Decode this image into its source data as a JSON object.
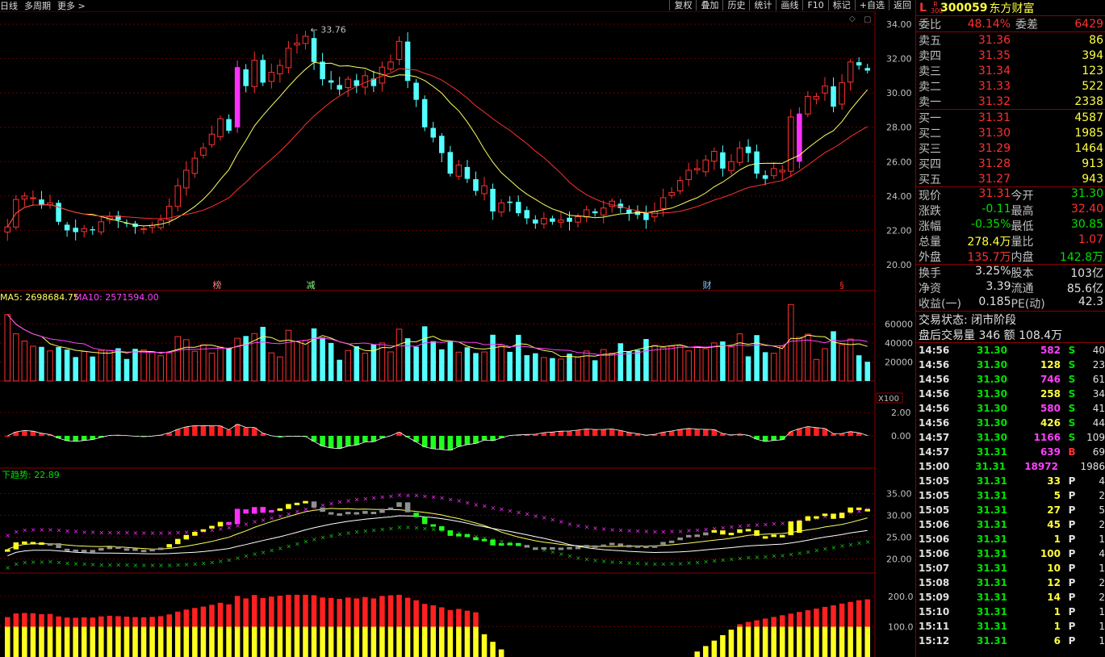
{
  "toolbar": {
    "left": [
      "日线",
      "多周期",
      "更多 >"
    ],
    "right": [
      "复权",
      "叠加",
      "历史",
      "统计",
      "画线",
      "F10",
      "标记",
      "+自选",
      "返回"
    ]
  },
  "stock": {
    "code": "300059",
    "name": "东方财富",
    "market_letter": "L",
    "market_sub": "R 300"
  },
  "weibi": {
    "label": "委比",
    "value": "48.14%",
    "label2": "委差",
    "value2": "6429"
  },
  "sell": [
    {
      "label": "卖五",
      "price": "31.36",
      "vol": "86"
    },
    {
      "label": "卖四",
      "price": "31.35",
      "vol": "394"
    },
    {
      "label": "卖三",
      "price": "31.34",
      "vol": "123"
    },
    {
      "label": "卖二",
      "price": "31.33",
      "vol": "522"
    },
    {
      "label": "卖一",
      "price": "31.32",
      "vol": "2338"
    }
  ],
  "buy": [
    {
      "label": "买一",
      "price": "31.31",
      "vol": "4587"
    },
    {
      "label": "买二",
      "price": "31.30",
      "vol": "1985"
    },
    {
      "label": "买三",
      "price": "31.29",
      "vol": "1464"
    },
    {
      "label": "买四",
      "price": "31.28",
      "vol": "913"
    },
    {
      "label": "买五",
      "price": "31.27",
      "vol": "943"
    }
  ],
  "quote1": [
    {
      "a": "现价",
      "av": "31.31",
      "ac": "up",
      "b": "今开",
      "bv": "31.30",
      "bc": "dn"
    },
    {
      "a": "涨跌",
      "av": "-0.11",
      "ac": "dn",
      "b": "最高",
      "bv": "32.40",
      "bc": "up"
    },
    {
      "a": "涨幅",
      "av": "-0.35%",
      "ac": "dn",
      "b": "最低",
      "bv": "30.85",
      "bc": "dn"
    },
    {
      "a": "总量",
      "av": "278.4万",
      "ac": "yel",
      "b": "量比",
      "bv": "1.07",
      "bc": "up"
    },
    {
      "a": "外盘",
      "av": "135.7万",
      "ac": "up",
      "b": "内盘",
      "bv": "142.8万",
      "bc": "dn"
    }
  ],
  "quote2": [
    {
      "a": "换手",
      "av": "3.25%",
      "b": "股本",
      "bv": "103亿"
    },
    {
      "a": "净资",
      "av": "3.39",
      "b": "流通",
      "bv": "85.6亿"
    },
    {
      "a": "收益(一)",
      "av": "0.185",
      "b": "PE(动)",
      "bv": "42.3"
    }
  ],
  "status": {
    "line1": "交易状态: 闭市阶段",
    "line2": "盘后交易量 346 额 108.4万"
  },
  "ticks": [
    {
      "t": "14:56",
      "p": "31.30",
      "pc": "dn",
      "v": "582",
      "vc": "mag",
      "d": "S",
      "dc": "dn",
      "n": "40"
    },
    {
      "t": "14:56",
      "p": "31.30",
      "pc": "dn",
      "v": "128",
      "vc": "yel",
      "d": "S",
      "dc": "dn",
      "n": "23"
    },
    {
      "t": "14:56",
      "p": "31.30",
      "pc": "dn",
      "v": "746",
      "vc": "mag",
      "d": "S",
      "dc": "dn",
      "n": "61"
    },
    {
      "t": "14:56",
      "p": "31.30",
      "pc": "dn",
      "v": "258",
      "vc": "yel",
      "d": "S",
      "dc": "dn",
      "n": "34"
    },
    {
      "t": "14:56",
      "p": "31.30",
      "pc": "dn",
      "v": "580",
      "vc": "mag",
      "d": "S",
      "dc": "dn",
      "n": "41"
    },
    {
      "t": "14:56",
      "p": "31.30",
      "pc": "dn",
      "v": "426",
      "vc": "yel",
      "d": "S",
      "dc": "dn",
      "n": "44"
    },
    {
      "t": "14:57",
      "p": "31.30",
      "pc": "dn",
      "v": "1166",
      "vc": "mag",
      "d": "S",
      "dc": "dn",
      "n": "109"
    },
    {
      "t": "14:57",
      "p": "31.31",
      "pc": "dn",
      "v": "639",
      "vc": "mag",
      "d": "B",
      "dc": "up",
      "n": "69"
    },
    {
      "t": "15:00",
      "p": "31.31",
      "pc": "dn",
      "v": "18972",
      "vc": "mag",
      "d": "",
      "dc": "dn",
      "n": "1986"
    },
    {
      "t": "15:05",
      "p": "31.31",
      "pc": "dn",
      "v": "33",
      "vc": "yel",
      "d": "P",
      "dc": "wht",
      "n": "4"
    },
    {
      "t": "15:05",
      "p": "31.31",
      "pc": "dn",
      "v": "5",
      "vc": "yel",
      "d": "P",
      "dc": "wht",
      "n": "2"
    },
    {
      "t": "15:05",
      "p": "31.31",
      "pc": "dn",
      "v": "27",
      "vc": "yel",
      "d": "P",
      "dc": "wht",
      "n": "5"
    },
    {
      "t": "15:06",
      "p": "31.31",
      "pc": "dn",
      "v": "45",
      "vc": "yel",
      "d": "P",
      "dc": "wht",
      "n": "2"
    },
    {
      "t": "15:06",
      "p": "31.31",
      "pc": "dn",
      "v": "1",
      "vc": "yel",
      "d": "P",
      "dc": "wht",
      "n": "1"
    },
    {
      "t": "15:06",
      "p": "31.31",
      "pc": "dn",
      "v": "100",
      "vc": "yel",
      "d": "P",
      "dc": "wht",
      "n": "4"
    },
    {
      "t": "15:07",
      "p": "31.31",
      "pc": "dn",
      "v": "10",
      "vc": "yel",
      "d": "P",
      "dc": "wht",
      "n": "1"
    },
    {
      "t": "15:08",
      "p": "31.31",
      "pc": "dn",
      "v": "12",
      "vc": "yel",
      "d": "P",
      "dc": "wht",
      "n": "2"
    },
    {
      "t": "15:09",
      "p": "31.31",
      "pc": "dn",
      "v": "14",
      "vc": "yel",
      "d": "P",
      "dc": "wht",
      "n": "2"
    },
    {
      "t": "15:10",
      "p": "31.31",
      "pc": "dn",
      "v": "1",
      "vc": "yel",
      "d": "P",
      "dc": "wht",
      "n": "1"
    },
    {
      "t": "15:11",
      "p": "31.31",
      "pc": "dn",
      "v": "1",
      "vc": "yel",
      "d": "P",
      "dc": "wht",
      "n": "1"
    },
    {
      "t": "15:12",
      "p": "31.31",
      "pc": "dn",
      "v": "6",
      "vc": "yel",
      "d": "P",
      "dc": "wht",
      "n": "1"
    }
  ],
  "chart_data": [
    {
      "type": "candlestick",
      "ylim": [
        20,
        34
      ],
      "yticks": [
        "34.00",
        "32.00",
        "30.00",
        "28.00",
        "26.00",
        "24.00",
        "22.00",
        "20.00"
      ],
      "high_label": "33.76",
      "markers": [
        "榜",
        "减",
        "财",
        "§"
      ],
      "close": [
        22.2,
        23.8,
        24.0,
        23.9,
        23.5,
        23.6,
        22.5,
        22.0,
        21.9,
        22.1,
        22.0,
        22.5,
        22.8,
        22.6,
        22.4,
        22.2,
        22.1,
        22.3,
        22.6,
        23.4,
        24.6,
        25.5,
        26.2,
        26.8,
        27.6,
        28.5,
        27.8,
        31.5,
        30.4,
        31.9,
        30.6,
        31.2,
        31.6,
        32.6,
        32.9,
        33.3,
        31.8,
        30.8,
        30.6,
        30.2,
        30.8,
        30.4,
        31.0,
        30.4,
        31.5,
        31.8,
        33.0,
        30.7,
        29.6,
        28.0,
        27.4,
        26.5,
        25.3,
        25.8,
        25.0,
        24.3,
        24.6,
        23.1,
        23.6,
        23.6,
        23.0,
        22.7,
        22.4,
        22.7,
        22.5,
        22.6,
        22.5,
        22.8,
        23.2,
        23.0,
        23.3,
        23.7,
        23.3,
        23.0,
        22.9,
        22.6,
        23.1,
        23.9,
        24.2,
        24.9,
        25.5,
        25.6,
        26.1,
        26.6,
        25.6,
        26.0,
        26.8,
        26.5,
        25.3,
        25.0,
        25.6,
        25.5,
        28.6,
        28.8,
        29.8,
        29.8,
        30.4,
        29.2,
        30.6,
        31.8,
        31.6,
        31.3
      ],
      "volume_labels": {
        "ma5": "MA5: 2698684.75",
        "ma10": "MA10: 2571594.00",
        "unit": "X100",
        "yticks": [
          "60000",
          "40000",
          "20000"
        ]
      },
      "macd_yticks": [
        "2.00",
        "0.00"
      ],
      "trend_label": "下趋势: 22.89",
      "trend_yticks": [
        "35.00",
        "30.00",
        "25.00",
        "20.00"
      ],
      "bottom_yticks": [
        "200.0",
        "100.0"
      ]
    }
  ]
}
